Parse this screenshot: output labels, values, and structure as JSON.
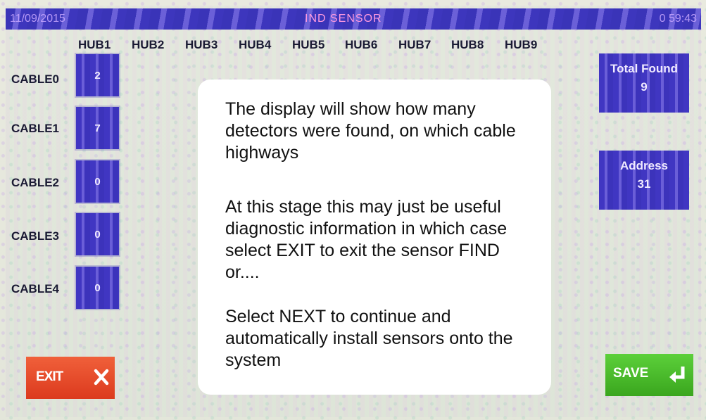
{
  "titlebar": {
    "date": "11/09/2015",
    "title": "IND SENSOR",
    "time": "0 59:43"
  },
  "hubs": [
    "HUB1",
    "HUB2",
    "HUB3",
    "HUB4",
    "HUB5",
    "HUB6",
    "HUB7",
    "HUB8",
    "HUB9"
  ],
  "cables": [
    {
      "label": "CABLE0",
      "count": "2"
    },
    {
      "label": "CABLE1",
      "count": "7"
    },
    {
      "label": "CABLE2",
      "count": "0"
    },
    {
      "label": "CABLE3",
      "count": "0"
    },
    {
      "label": "CABLE4",
      "count": "0"
    }
  ],
  "total_found": {
    "label": "Total Found",
    "value": "9"
  },
  "address": {
    "label": "Address",
    "value": "31"
  },
  "buttons": {
    "exit_label": "EXIT",
    "save_label": "SAVE"
  },
  "overlay": {
    "para1": "The display will show how many detectors were found, on which cable highways",
    "para2": "At this stage this may just be useful diagnostic information in which case select EXIT to exit the sensor FIND or....",
    "para3": "Select NEXT to continue and automatically install sensors onto the system"
  },
  "colors": {
    "titlebar": "#3a34b8",
    "box": "#4036c2",
    "exit": "#e8482a",
    "save": "#4cc22e"
  },
  "icons": {
    "exit": "close-icon",
    "save": "enter-return-icon"
  }
}
